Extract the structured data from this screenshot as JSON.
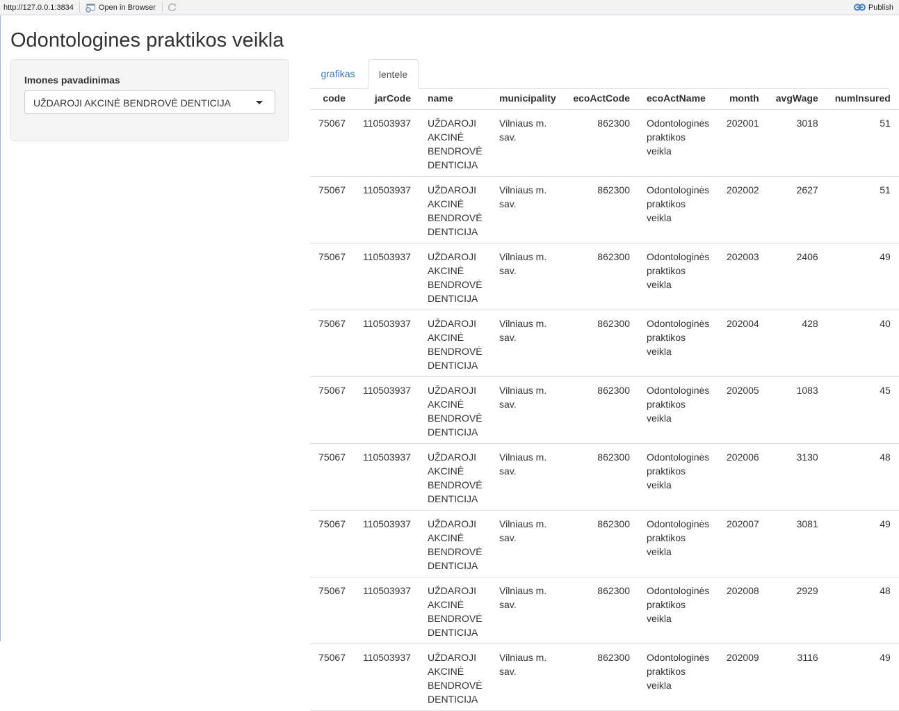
{
  "viewer": {
    "url": "http://127.0.0.1:3834",
    "open_in_browser": "Open in Browser",
    "publish": "Publish"
  },
  "page_title": "Odontologines praktikos veikla",
  "sidebar": {
    "label": "Imones pavadinimas",
    "selected": "UŽDAROJI AKCINĖ BENDROVĖ DENTICIJA"
  },
  "tabs": [
    {
      "label": "grafikas",
      "active": false
    },
    {
      "label": "lentele",
      "active": true
    }
  ],
  "table": {
    "columns": [
      "code",
      "jarCode",
      "name",
      "municipality",
      "ecoActCode",
      "ecoActName",
      "month",
      "avgWage",
      "numInsured"
    ],
    "rows": [
      [
        "75067",
        "110503937",
        "UŽDAROJI AKCINĖ BENDROVĖ DENTICIJA",
        "Vilniaus m. sav.",
        "862300",
        "Odontologinės praktikos veikla",
        "202001",
        "3018",
        "51"
      ],
      [
        "75067",
        "110503937",
        "UŽDAROJI AKCINĖ BENDROVĖ DENTICIJA",
        "Vilniaus m. sav.",
        "862300",
        "Odontologinės praktikos veikla",
        "202002",
        "2627",
        "51"
      ],
      [
        "75067",
        "110503937",
        "UŽDAROJI AKCINĖ BENDROVĖ DENTICIJA",
        "Vilniaus m. sav.",
        "862300",
        "Odontologinės praktikos veikla",
        "202003",
        "2406",
        "49"
      ],
      [
        "75067",
        "110503937",
        "UŽDAROJI AKCINĖ BENDROVĖ DENTICIJA",
        "Vilniaus m. sav.",
        "862300",
        "Odontologinės praktikos veikla",
        "202004",
        "428",
        "40"
      ],
      [
        "75067",
        "110503937",
        "UŽDAROJI AKCINĖ BENDROVĖ DENTICIJA",
        "Vilniaus m. sav.",
        "862300",
        "Odontologinės praktikos veikla",
        "202005",
        "1083",
        "45"
      ],
      [
        "75067",
        "110503937",
        "UŽDAROJI AKCINĖ BENDROVĖ DENTICIJA",
        "Vilniaus m. sav.",
        "862300",
        "Odontologinės praktikos veikla",
        "202006",
        "3130",
        "48"
      ],
      [
        "75067",
        "110503937",
        "UŽDAROJI AKCINĖ BENDROVĖ DENTICIJA",
        "Vilniaus m. sav.",
        "862300",
        "Odontologinės praktikos veikla",
        "202007",
        "3081",
        "49"
      ],
      [
        "75067",
        "110503937",
        "UŽDAROJI AKCINĖ BENDROVĖ DENTICIJA",
        "Vilniaus m. sav.",
        "862300",
        "Odontologinės praktikos veikla",
        "202008",
        "2929",
        "48"
      ],
      [
        "75067",
        "110503937",
        "UŽDAROJI AKCINĖ BENDROVĖ DENTICIJA",
        "Vilniaus m. sav.",
        "862300",
        "Odontologinės praktikos veikla",
        "202009",
        "3116",
        "49"
      ]
    ]
  }
}
